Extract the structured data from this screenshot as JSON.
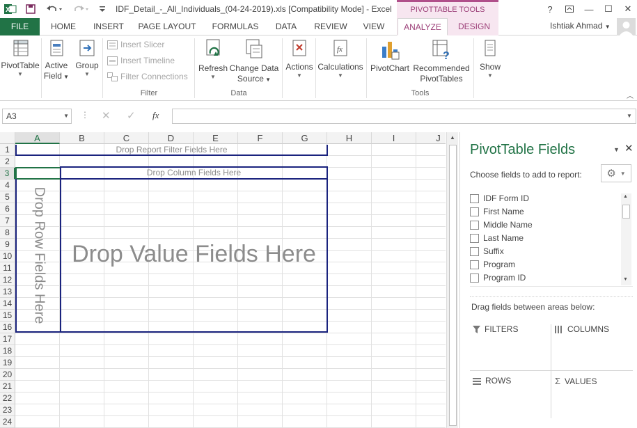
{
  "window": {
    "title": "IDF_Detail_-_All_Individuals_(04-24-2019).xls  [Compatibility Mode] - Excel",
    "context_tab_header": "PIVOTTABLE TOOLS",
    "controls": {
      "help": "?",
      "restore": "🗗",
      "minimize": "—",
      "maximize": "☐",
      "close": "✕"
    }
  },
  "tabs": [
    "FILE",
    "HOME",
    "INSERT",
    "PAGE LAYOUT",
    "FORMULAS",
    "DATA",
    "REVIEW",
    "VIEW",
    "ANALYZE",
    "DESIGN"
  ],
  "active_tab": "ANALYZE",
  "user": {
    "name": "Ishtiak Ahmad"
  },
  "ribbon": {
    "pivottable": "PivotTable",
    "active_field_1": "Active",
    "active_field_2": "Field",
    "group": "Group",
    "insert_slicer": "Insert Slicer",
    "insert_timeline": "Insert Timeline",
    "filter_connections": "Filter Connections",
    "filter_group": "Filter",
    "refresh": "Refresh",
    "change_data_1": "Change Data",
    "change_data_2": "Source",
    "data_group": "Data",
    "actions": "Actions",
    "calculations": "Calculations",
    "pivotchart": "PivotChart",
    "recommended_1": "Recommended",
    "recommended_2": "PivotTables",
    "tools_group": "Tools",
    "show": "Show"
  },
  "formula_bar": {
    "name_box": "A3",
    "formula": ""
  },
  "columns": [
    "A",
    "B",
    "C",
    "D",
    "E",
    "F",
    "G",
    "H",
    "I",
    "J"
  ],
  "rows": [
    "1",
    "2",
    "3",
    "4",
    "5",
    "6",
    "7",
    "8",
    "9",
    "10",
    "11",
    "12",
    "13",
    "14",
    "15",
    "16",
    "17",
    "18",
    "19",
    "20",
    "21",
    "22",
    "23",
    "24"
  ],
  "pivot_placeholders": {
    "filter": "Drop Report Filter Fields Here",
    "column": "Drop Column Fields Here",
    "row": "Drop Row Fields Here",
    "value": "Drop Value Fields Here"
  },
  "pane": {
    "title": "PivotTable Fields",
    "subtitle": "Choose fields to add to report:",
    "fields": [
      "IDF Form ID",
      "First Name",
      "Middle Name",
      "Last Name",
      "Suffix",
      "Program",
      "Program ID"
    ],
    "drag_label": "Drag fields between areas below:",
    "areas": {
      "filters": "FILTERS",
      "columns": "COLUMNS",
      "rows": "ROWS",
      "values": "VALUES"
    }
  },
  "colors": {
    "excel_green": "#217346",
    "context_pink": "#9c3f78",
    "pivot_border": "#1a237e"
  }
}
